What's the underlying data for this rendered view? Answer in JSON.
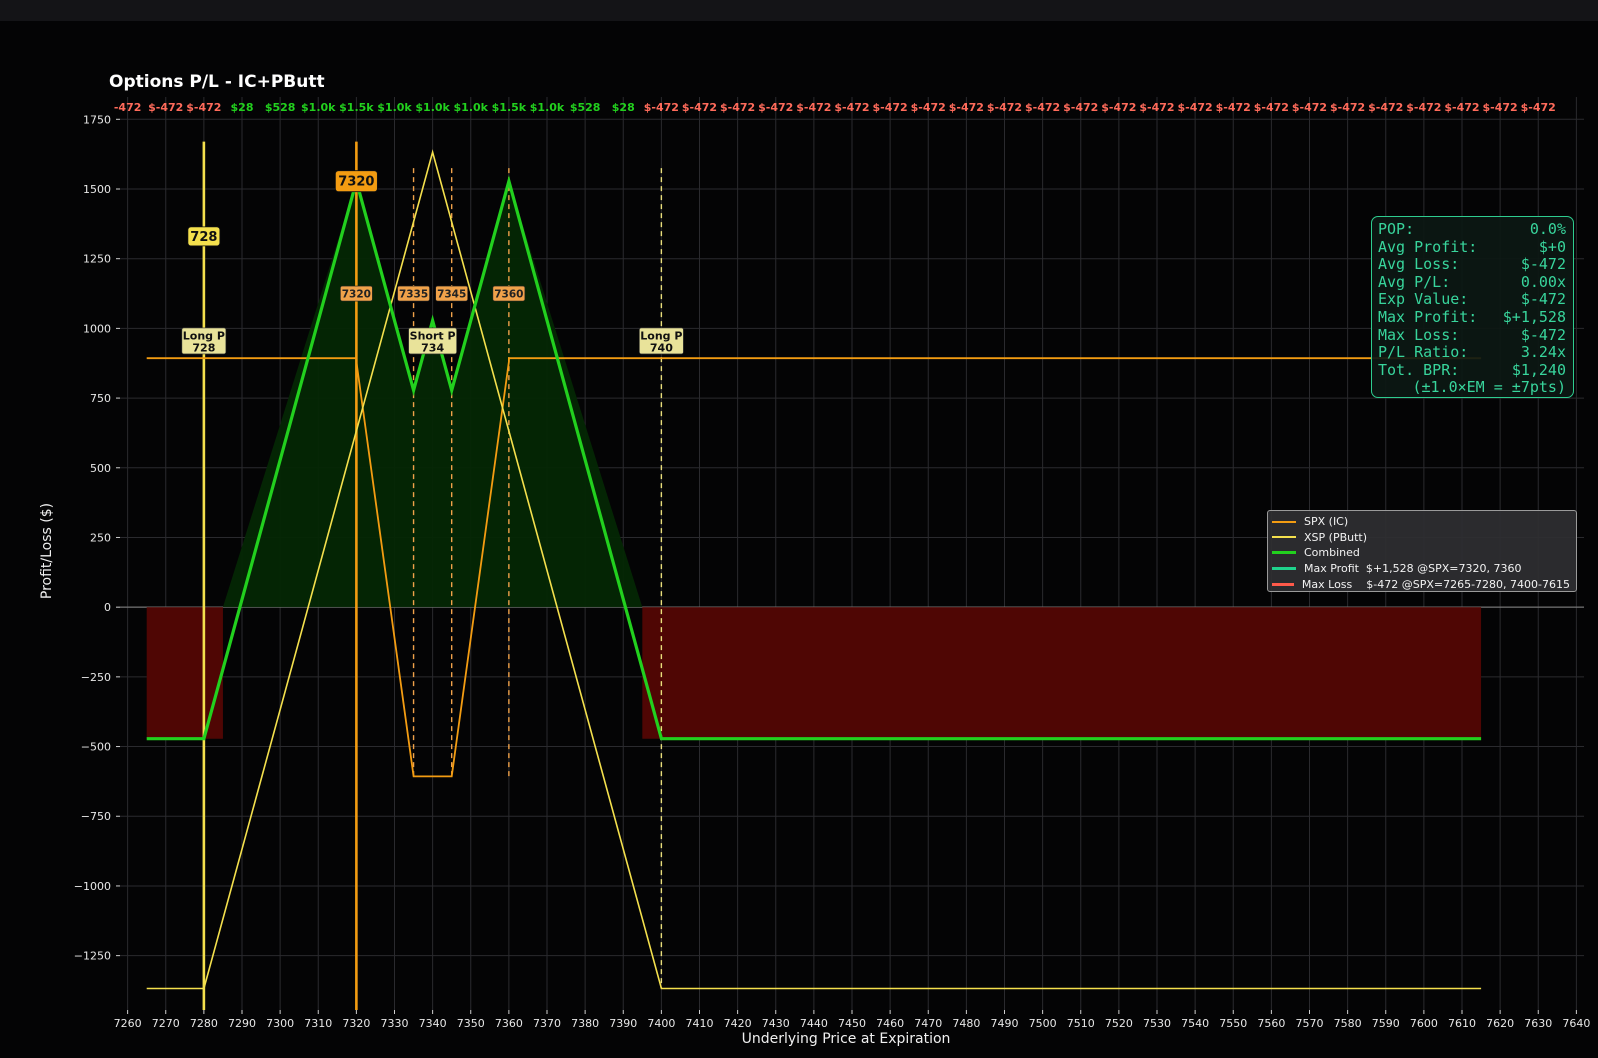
{
  "chart_data": {
    "type": "line",
    "title": "Options P/L - IC+PButt",
    "xlabel": "Underlying Price at Expiration",
    "ylabel": "Profit/Loss ($)",
    "xlim": [
      7258,
      7642
    ],
    "ylim": [
      -1445,
      1830
    ],
    "x_ticks": [
      7260,
      7270,
      7280,
      7290,
      7300,
      7310,
      7320,
      7330,
      7340,
      7350,
      7360,
      7370,
      7380,
      7390,
      7400,
      7410,
      7420,
      7430,
      7440,
      7450,
      7460,
      7470,
      7480,
      7490,
      7500,
      7510,
      7520,
      7530,
      7540,
      7550,
      7560,
      7570,
      7580,
      7590,
      7600,
      7610,
      7620,
      7630,
      7640
    ],
    "y_ticks": [
      -1250,
      -1000,
      -750,
      -500,
      -250,
      0,
      250,
      500,
      750,
      1000,
      1250,
      1500,
      1750
    ],
    "y_tick_labels": [
      "−1250",
      "−1000",
      "−750",
      "−500",
      "−250",
      "0",
      "250",
      "500",
      "750",
      "1000",
      "1250",
      "1500",
      "1750"
    ],
    "grid": true,
    "legend_position": "right",
    "series": [
      {
        "name": "SPX (IC)",
        "color": "#f39c12",
        "x": [
          7265,
          7320,
          7320,
          7335,
          7345,
          7360,
          7360,
          7615
        ],
        "y": [
          893,
          893,
          880,
          -607,
          -607,
          880,
          893,
          893
        ]
      },
      {
        "name": "XSP (PButt)",
        "color": "#f4e04d",
        "x": [
          7265,
          7280,
          7340,
          7400,
          7615
        ],
        "y": [
          -1368,
          -1368,
          1632,
          -1368,
          -1368
        ]
      },
      {
        "name": "Combined",
        "color": "#22d01e",
        "x": [
          7265,
          7280,
          7320,
          7335,
          7340,
          7345,
          7360,
          7400,
          7615
        ],
        "y": [
          -472,
          -472,
          1528,
          778,
          1028,
          778,
          1528,
          -472,
          -472
        ]
      }
    ],
    "loss_zones": [
      [
        7265,
        7285
      ],
      [
        7395,
        7615
      ]
    ],
    "profit_zone": [
      7285,
      7395
    ],
    "strike_lines": [
      {
        "x": 7280,
        "color": "#f4e04d",
        "style": "solid",
        "tag": "728"
      },
      {
        "x": 7320,
        "color": "#f39c12",
        "style": "solid",
        "tag": "7320"
      },
      {
        "x": 7335,
        "color": "#f0a24a",
        "style": "dashed"
      },
      {
        "x": 7345,
        "color": "#f0a24a",
        "style": "dashed"
      },
      {
        "x": 7360,
        "color": "#f0a24a",
        "style": "dashed"
      },
      {
        "x": 7400,
        "color": "#eadf7c",
        "style": "dashed"
      }
    ],
    "strike_badges": [
      {
        "x": 7320,
        "text": "7320"
      },
      {
        "x": 7335,
        "text": "7335"
      },
      {
        "x": 7345,
        "text": "7345"
      },
      {
        "x": 7360,
        "text": "7360"
      }
    ],
    "leg_labels": [
      {
        "x": 7280,
        "line1": "Long P",
        "line2": "728"
      },
      {
        "x": 7340,
        "line1": "Short P",
        "line2": "734"
      },
      {
        "x": 7400,
        "line1": "Long P",
        "line2": "740"
      }
    ],
    "top_pl_labels": [
      {
        "x": 7260,
        "text": "-472",
        "positive": false
      },
      {
        "x": 7270,
        "text": "$-472",
        "positive": false
      },
      {
        "x": 7280,
        "text": "$-472",
        "positive": false
      },
      {
        "x": 7290,
        "text": "$28",
        "positive": true
      },
      {
        "x": 7300,
        "text": "$528",
        "positive": true
      },
      {
        "x": 7310,
        "text": "$1.0k",
        "positive": true
      },
      {
        "x": 7320,
        "text": "$1.5k",
        "positive": true
      },
      {
        "x": 7330,
        "text": "$1.0k",
        "positive": true
      },
      {
        "x": 7340,
        "text": "$1.0k",
        "positive": true
      },
      {
        "x": 7350,
        "text": "$1.0k",
        "positive": true
      },
      {
        "x": 7360,
        "text": "$1.5k",
        "positive": true
      },
      {
        "x": 7370,
        "text": "$1.0k",
        "positive": true
      },
      {
        "x": 7380,
        "text": "$528",
        "positive": true
      },
      {
        "x": 7390,
        "text": "$28",
        "positive": true
      },
      {
        "x": 7400,
        "text": "$-472",
        "positive": false
      },
      {
        "x": 7410,
        "text": "$-472",
        "positive": false
      },
      {
        "x": 7420,
        "text": "$-472",
        "positive": false
      },
      {
        "x": 7430,
        "text": "$-472",
        "positive": false
      },
      {
        "x": 7440,
        "text": "$-472",
        "positive": false
      },
      {
        "x": 7450,
        "text": "$-472",
        "positive": false
      },
      {
        "x": 7460,
        "text": "$-472",
        "positive": false
      },
      {
        "x": 7470,
        "text": "$-472",
        "positive": false
      },
      {
        "x": 7480,
        "text": "$-472",
        "positive": false
      },
      {
        "x": 7490,
        "text": "$-472",
        "positive": false
      },
      {
        "x": 7500,
        "text": "$-472",
        "positive": false
      },
      {
        "x": 7510,
        "text": "$-472",
        "positive": false
      },
      {
        "x": 7520,
        "text": "$-472",
        "positive": false
      },
      {
        "x": 7530,
        "text": "$-472",
        "positive": false
      },
      {
        "x": 7540,
        "text": "$-472",
        "positive": false
      },
      {
        "x": 7550,
        "text": "$-472",
        "positive": false
      },
      {
        "x": 7560,
        "text": "$-472",
        "positive": false
      },
      {
        "x": 7570,
        "text": "$-472",
        "positive": false
      },
      {
        "x": 7580,
        "text": "$-472",
        "positive": false
      },
      {
        "x": 7590,
        "text": "$-472",
        "positive": false
      },
      {
        "x": 7600,
        "text": "$-472",
        "positive": false
      },
      {
        "x": 7610,
        "text": "$-472",
        "positive": false
      },
      {
        "x": 7620,
        "text": "$-472",
        "positive": false
      },
      {
        "x": 7630,
        "text": "$-472",
        "positive": false
      }
    ],
    "colors": {
      "positive_text": "#22d01e",
      "negative_text": "#ff6b5b",
      "profit_fill": "#042704",
      "loss_fill": "#4f0604",
      "grid": "#2a2a2e",
      "axis_text": "#e8e8e8"
    }
  },
  "stats": {
    "rows": [
      {
        "label": "POP:",
        "value": "0.0%"
      },
      {
        "label": "Avg Profit:",
        "value": "$+0"
      },
      {
        "label": "Avg Loss:",
        "value": "$-472"
      },
      {
        "label": "Avg P/L:",
        "value": "0.00x"
      },
      {
        "label": "Exp Value:",
        "value": "$-472"
      },
      {
        "label": "Max Profit:",
        "value": "$+1,528"
      },
      {
        "label": "Max Loss:",
        "value": "$-472"
      },
      {
        "label": "P/L Ratio:",
        "value": "3.24x"
      },
      {
        "label": "Tot. BPR:",
        "value": "$1,240"
      }
    ],
    "note": "(±1.0×EM = ±7pts)"
  },
  "legend": {
    "items": [
      {
        "label": "SPX (IC)",
        "color": "#f39c12"
      },
      {
        "label": "XSP (PButt)",
        "color": "#f4e04d"
      },
      {
        "label": "Combined",
        "color": "#22d01e"
      },
      {
        "label": "Max Profit  $+1,528 @SPX=7320, 7360",
        "color": "#1fd28c"
      },
      {
        "label": "Max Loss    $-472 @SPX=7265-7280, 7400-7615",
        "color": "#ff5a4a"
      }
    ]
  }
}
